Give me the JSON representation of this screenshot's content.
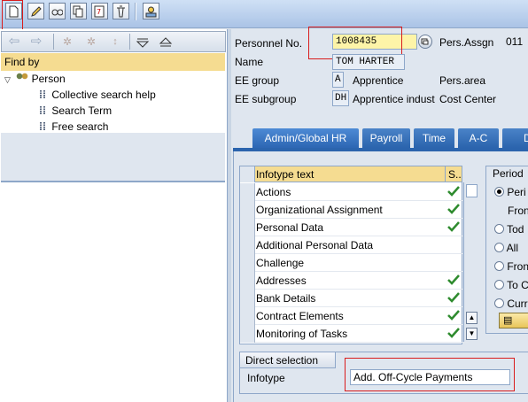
{
  "toolbar": {
    "buttons": [
      {
        "icon": "create-icon"
      },
      {
        "icon": "change-icon"
      },
      {
        "icon": "display-icon"
      },
      {
        "icon": "copy-icon"
      },
      {
        "icon": "delimit-icon"
      },
      {
        "icon": "delete-icon"
      },
      {
        "icon": "overview-icon"
      }
    ]
  },
  "nav": {
    "back_icon": "arrow-left-icon",
    "forward_icon": "arrow-right-icon"
  },
  "left": {
    "find_by": "Find by",
    "tree": {
      "person": "Person",
      "items": [
        "Collective search help",
        "Search Term",
        "Free search"
      ]
    }
  },
  "header": {
    "personnel_no_label": "Personnel No.",
    "personnel_no_value": "1008435",
    "pers_assgn_label": "Pers.Assgn",
    "pers_assgn_value": "011",
    "name_label": "Name",
    "name_value": "TOM HARTER",
    "ee_group_label": "EE group",
    "ee_group_code": "A",
    "ee_group_text": "Apprentice",
    "pers_area_label": "Pers.area",
    "ee_subgroup_label": "EE subgroup",
    "ee_subgroup_code": "DH",
    "ee_subgroup_text": "Apprentice indust",
    "cost_center_label": "Cost Center"
  },
  "tabs": [
    "Admin/Global HR",
    "Payroll",
    "Time",
    "A-C",
    "D"
  ],
  "infotypes": {
    "col_text": "Infotype text",
    "col_s": "S..",
    "rows": [
      {
        "text": "Actions",
        "checked": true
      },
      {
        "text": "Organizational Assignment",
        "checked": true
      },
      {
        "text": "Personal Data",
        "checked": true
      },
      {
        "text": "Additional Personal Data",
        "checked": false
      },
      {
        "text": "Challenge",
        "checked": false
      },
      {
        "text": "Addresses",
        "checked": true
      },
      {
        "text": "Bank Details",
        "checked": true
      },
      {
        "text": "Contract Elements",
        "checked": true
      },
      {
        "text": "Monitoring of Tasks",
        "checked": true
      }
    ]
  },
  "period": {
    "title": "Period",
    "options": [
      "Peri",
      "Fron",
      "Tod",
      "All",
      "Fron",
      "To C",
      "Curr"
    ]
  },
  "direct_selection": {
    "title": "Direct selection",
    "infotype_label": "Infotype",
    "infotype_value": "Add. Off-Cycle Payments"
  },
  "colors": {
    "tab_blue": "#2b64ad",
    "header_yellow": "#f5dc91",
    "highlight_red": "#d91c1c",
    "check_green": "#2e8b2e"
  }
}
